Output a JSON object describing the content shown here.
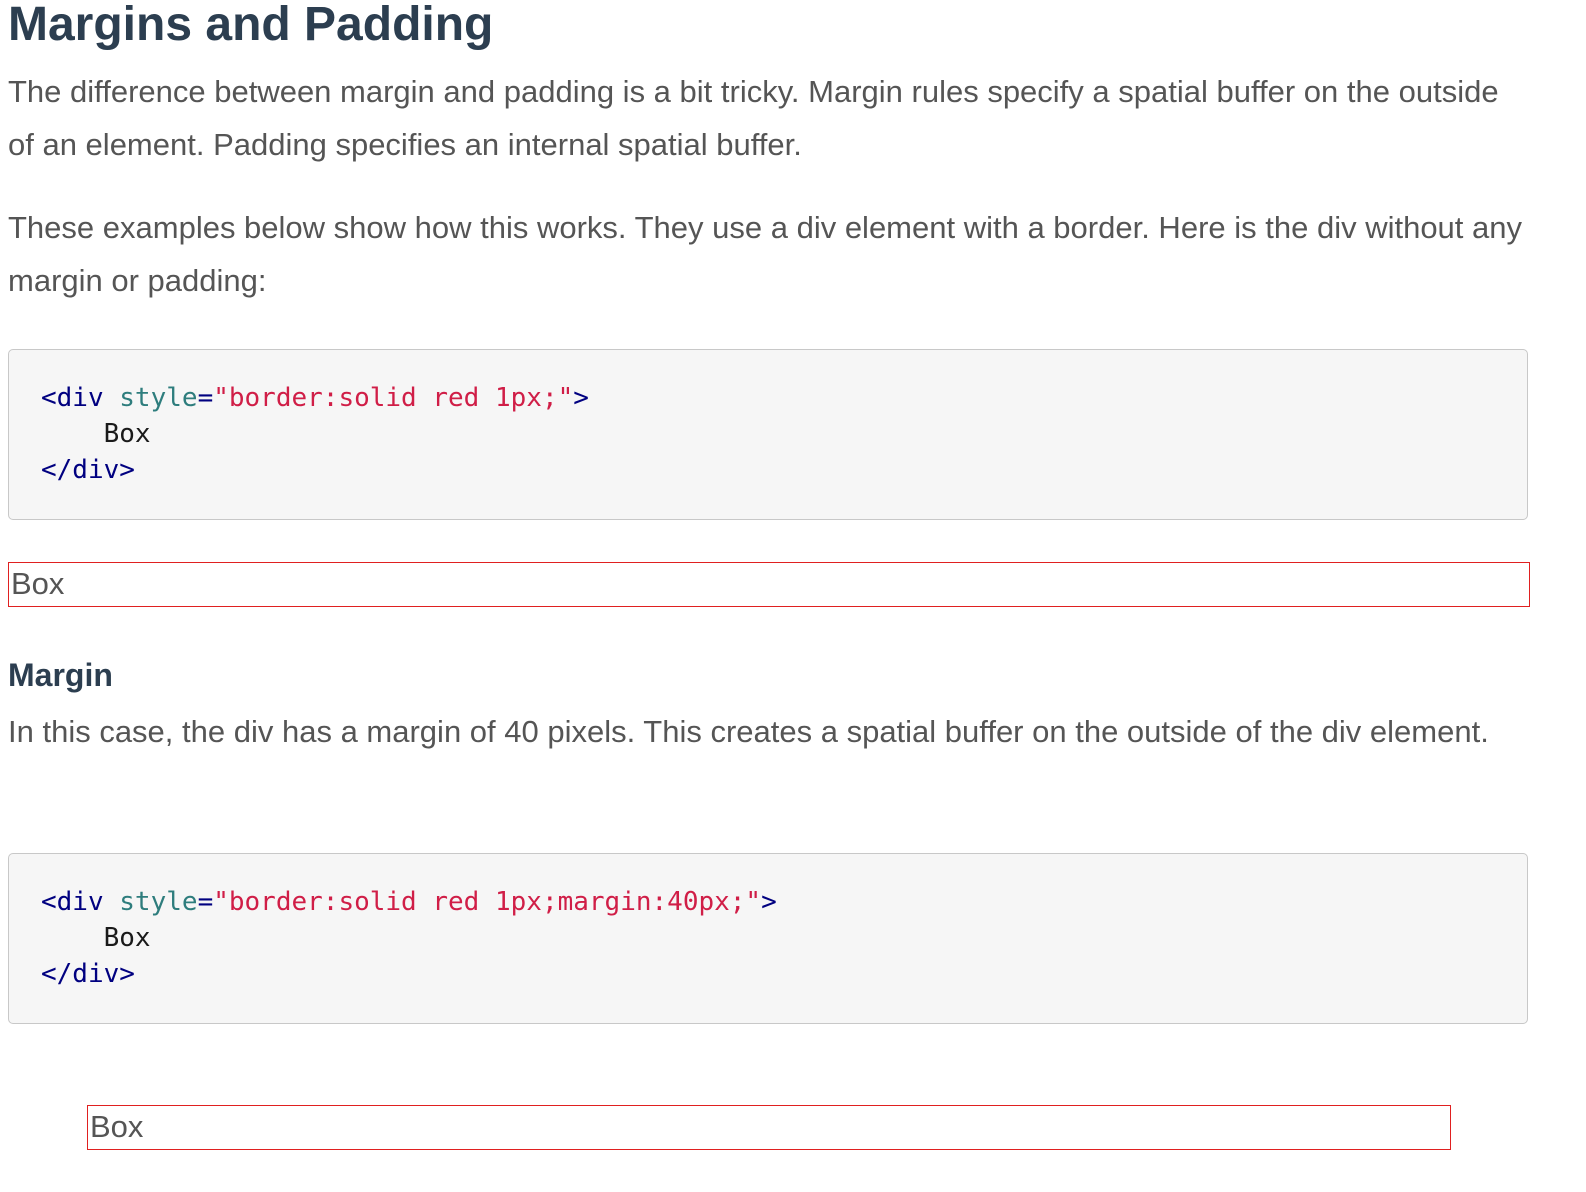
{
  "heading": "Margins and Padding",
  "intro_paragraph": "The difference between margin and padding is a bit tricky. Margin rules specify a spatial buffer on the outside of an element. Padding specifies an internal spatial buffer.",
  "examples_paragraph": "These examples below show how this works. They use a div element with a border. Here is the div without any margin or padding:",
  "example1": {
    "code": {
      "open_tag": "<div",
      "attr_name": "style",
      "equals": "=",
      "attr_value": "\"border:solid red 1px;\"",
      "close_bracket": ">",
      "inner_text": "Box",
      "end_tag": "</div>"
    },
    "rendered_text": "Box"
  },
  "margin_section": {
    "heading": "Margin",
    "paragraph": "In this case, the div has a margin of 40 pixels. This creates a spatial buffer on the outside of the div element."
  },
  "example2": {
    "code": {
      "open_tag": "<div",
      "attr_name": "style",
      "equals": "=",
      "attr_value": "\"border:solid red 1px;margin:40px;\"",
      "close_bracket": ">",
      "inner_text": "Box",
      "end_tag": "</div>"
    },
    "rendered_text": "Box"
  },
  "colors": {
    "heading": "#2c3e50",
    "body_text": "#555555",
    "code_background": "#f6f6f6",
    "code_tag": "#000080",
    "code_attribute": "#2e7d7d",
    "code_string": "#d01e47",
    "box_border": "#e02020"
  }
}
